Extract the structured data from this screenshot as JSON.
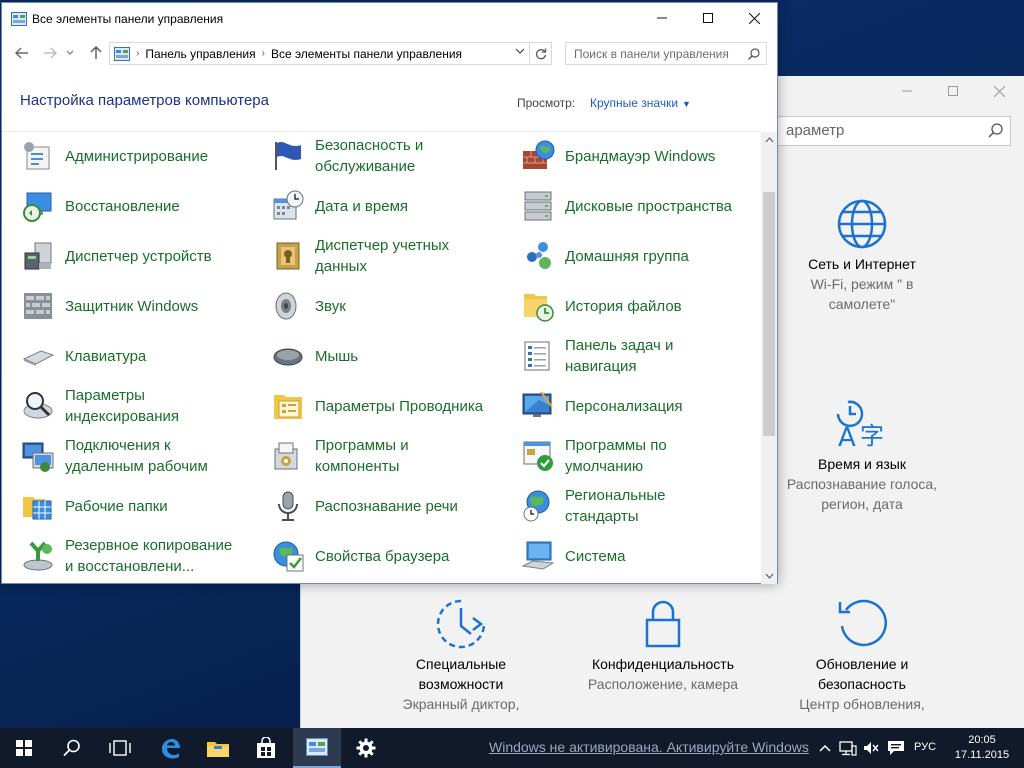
{
  "control_panel": {
    "title": "Все элементы панели управления",
    "breadcrumb": [
      "Панель управления",
      "Все элементы панели управления"
    ],
    "search_placeholder": "Поиск в панели управления",
    "heading": "Настройка параметров компьютера",
    "view_label": "Просмотр:",
    "view_value": "Крупные значки",
    "columns": [
      [
        {
          "label": "Администрирование",
          "icon": "admin-tools-icon"
        },
        {
          "label": "Восстановление",
          "icon": "recovery-icon"
        },
        {
          "label": "Диспетчер устройств",
          "icon": "device-manager-icon"
        },
        {
          "label": "Защитник Windows",
          "icon": "windows-defender-icon"
        },
        {
          "label": "Клавиатура",
          "icon": "keyboard-icon"
        },
        {
          "label": "Параметры индексирования",
          "icon": "indexing-icon"
        },
        {
          "label": "Подключения к удаленным рабочим",
          "icon": "remote-desktop-icon"
        },
        {
          "label": "Рабочие папки",
          "icon": "work-folders-icon"
        },
        {
          "label": "Резервное копирование и восстановлени...",
          "icon": "backup-icon"
        }
      ],
      [
        {
          "label": "Безопасность и обслуживание",
          "icon": "security-flag-icon"
        },
        {
          "label": "Дата и время",
          "icon": "date-time-icon"
        },
        {
          "label": "Диспетчер учетных данных",
          "icon": "credential-manager-icon"
        },
        {
          "label": "Звук",
          "icon": "sound-icon"
        },
        {
          "label": "Мышь",
          "icon": "mouse-icon"
        },
        {
          "label": "Параметры Проводника",
          "icon": "explorer-options-icon"
        },
        {
          "label": "Программы и компоненты",
          "icon": "programs-icon"
        },
        {
          "label": "Распознавание речи",
          "icon": "microphone-icon"
        },
        {
          "label": "Свойства браузера",
          "icon": "internet-options-icon"
        }
      ],
      [
        {
          "label": "Брандмауэр Windows",
          "icon": "firewall-icon"
        },
        {
          "label": "Дисковые пространства",
          "icon": "storage-spaces-icon"
        },
        {
          "label": "Домашняя группа",
          "icon": "homegroup-icon"
        },
        {
          "label": "История файлов",
          "icon": "file-history-icon"
        },
        {
          "label": "Панель задач и навигация",
          "icon": "taskbar-icon"
        },
        {
          "label": "Персонализация",
          "icon": "personalization-icon"
        },
        {
          "label": "Программы по умолчанию",
          "icon": "default-programs-icon"
        },
        {
          "label": "Региональные стандарты",
          "icon": "region-icon"
        },
        {
          "label": "Система",
          "icon": "system-icon"
        }
      ]
    ]
  },
  "settings": {
    "search_text": "араметр",
    "tiles": [
      {
        "title": "Сеть и Интернет",
        "subtitle": "Wi-Fi, режим \" в самолете\"",
        "icon": "globe-icon"
      },
      {
        "title": "Время и язык",
        "subtitle": "Распознавание голоса, регион, дата",
        "icon": "time-language-icon"
      },
      {
        "title": "Специальные возможности",
        "subtitle": "Экранный диктор,",
        "icon": "accessibility-icon"
      },
      {
        "title": "Конфиденциальность",
        "subtitle": "Расположение, камера",
        "icon": "lock-icon"
      },
      {
        "title": "Обновление и безопасность",
        "subtitle": "Центр обновления,",
        "icon": "update-icon"
      }
    ]
  },
  "taskbar": {
    "activation_text": "Windows не активирована. Активируйте Windows",
    "language": "РУС",
    "time": "20:05",
    "date": "17.11.2015"
  },
  "colors": {
    "link_green": "#1a6e2a",
    "heading_blue": "#1e3287",
    "settings_blue": "#1a73d1",
    "taskbar": "#101a2a"
  }
}
